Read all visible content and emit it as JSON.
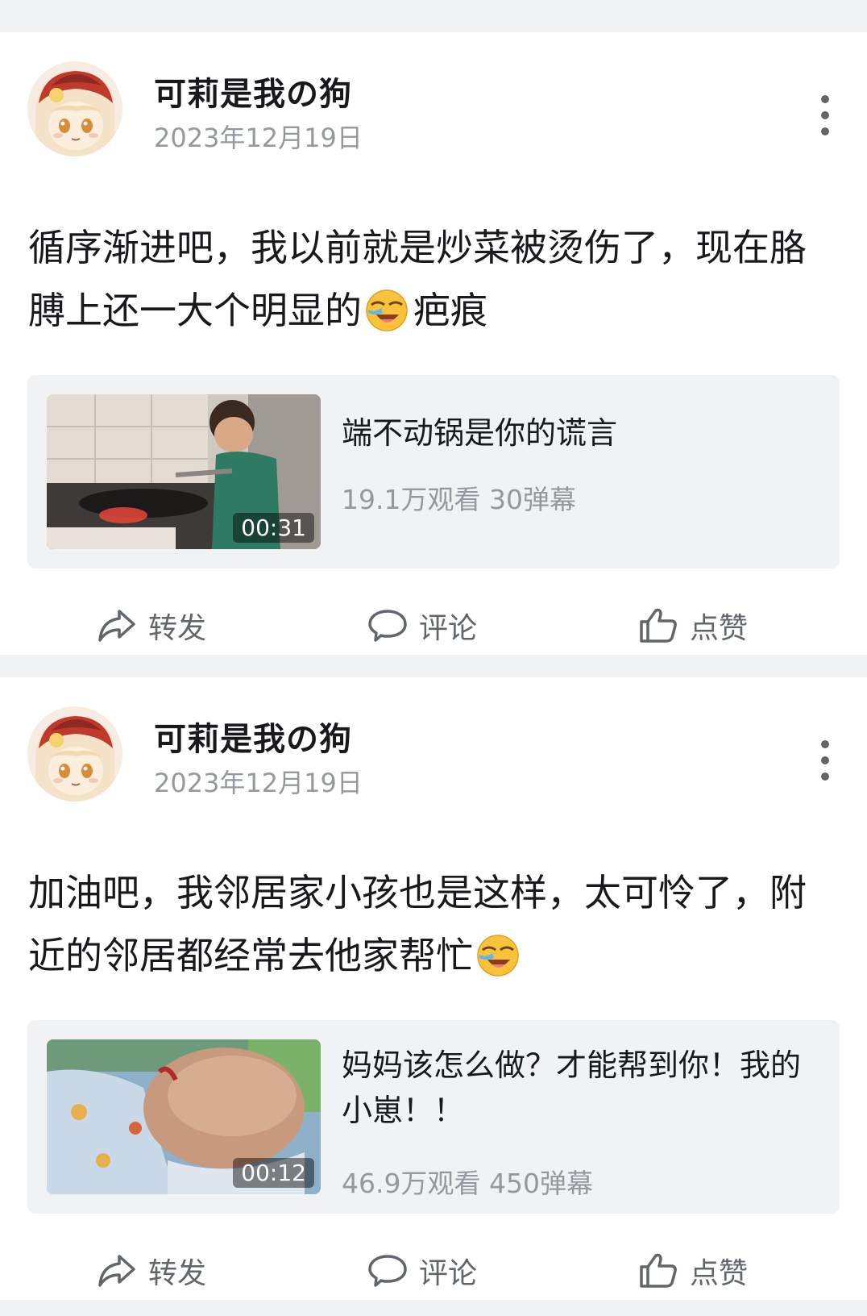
{
  "posts": [
    {
      "username": "可莉是我の狗",
      "date": "2023年12月19日",
      "text_before": "循序渐进吧，我以前就是炒菜被烫伤了，现在胳膊上还一大个明显的",
      "text_after": "疤痕",
      "emoji": "laughing-crying-emoji",
      "video": {
        "title": "端不动锅是你的谎言",
        "stats": "19.1万观看 30弹幕",
        "duration": "00:31"
      }
    },
    {
      "username": "可莉是我の狗",
      "date": "2023年12月19日",
      "text_before": "加油吧，我邻居家小孩也是这样，太可怜了，附近的邻居都经常去他家帮忙",
      "text_after": "",
      "emoji": "laughing-crying-emoji",
      "video": {
        "title": "妈妈该怎么做？才能帮到你！我的小崽！！",
        "stats": "46.9万观看 450弹幕",
        "duration": "00:12"
      }
    }
  ],
  "actions": {
    "share": "转发",
    "comment": "评论",
    "like": "点赞"
  },
  "colors": {
    "background": "#f1f2f3",
    "card": "#ffffff",
    "text_primary": "#18191c",
    "text_secondary": "#9499a0",
    "icon": "#61666d"
  }
}
